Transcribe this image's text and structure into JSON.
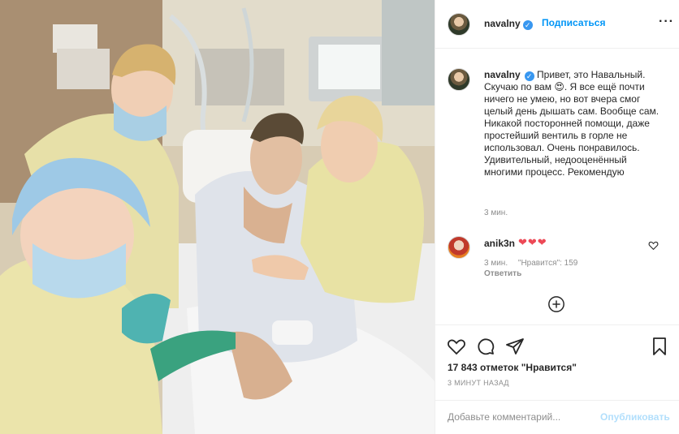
{
  "post": {
    "author": "navalny",
    "follow_label": "Подписаться",
    "verified_mark": "✓",
    "more_label": "···"
  },
  "caption": {
    "author": "navalny",
    "text": "Привет, это Навальный. Скучаю по вам 😍. Я все ещё почти ничего не умею, но вот вчера смог целый день дышать сам. Вообще сам. Никакой посторонней помощи, даже простейший вентиль в горле не использовал. Очень понравилось. Удивительный, недооценённый многими процесс. Рекомендую",
    "time": "3 мин."
  },
  "comment": {
    "author": "anik3n",
    "text": "❤❤❤",
    "time": "3 мин.",
    "likes": "\"Нравится\": 159",
    "reply_label": "Ответить"
  },
  "stats": {
    "likes_text": "17 843 отметок \"Нравится\"",
    "posted_ago": "3 МИНУТ НАЗАД"
  },
  "add_comment": {
    "placeholder": "Добавьте комментарий...",
    "publish_label": "Опубликовать"
  },
  "icons": [
    "heart-icon",
    "comment-icon",
    "share-icon",
    "bookmark-icon",
    "more-icon",
    "add-circle-icon",
    "verified-icon"
  ],
  "colors": {
    "accent": "#0095f6",
    "verified": "#3897f0",
    "heart": "#ed4956",
    "muted": "#8e8e8e"
  }
}
